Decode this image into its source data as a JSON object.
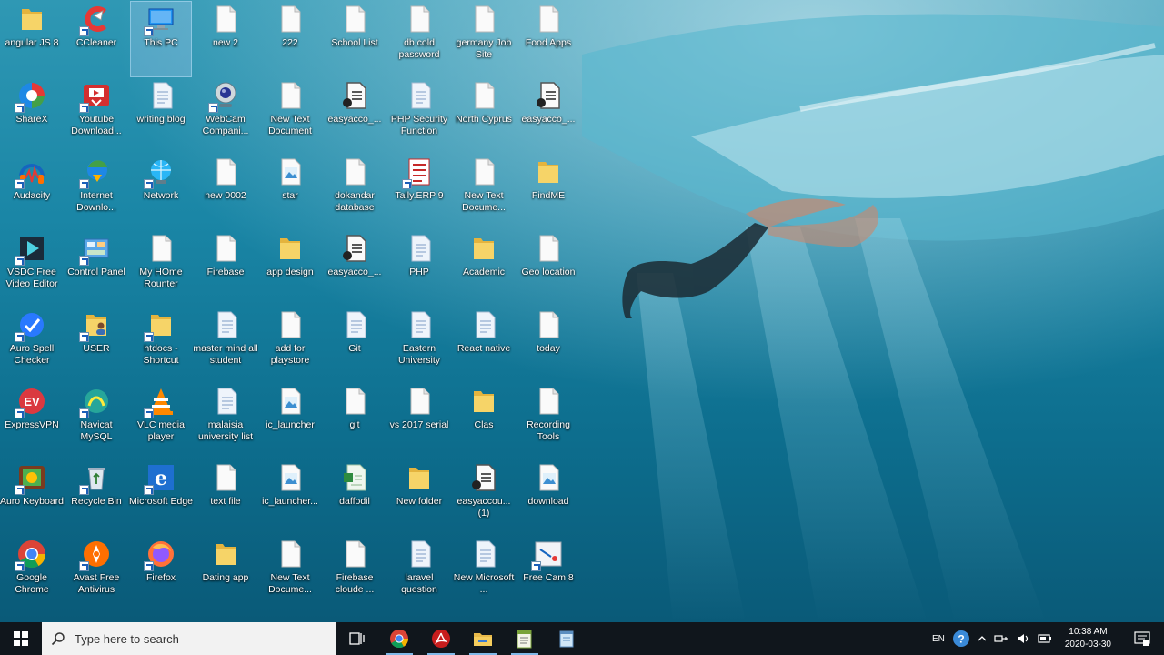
{
  "desktop_icons": [
    {
      "label": "angular JS 8",
      "type": "folder"
    },
    {
      "label": "ShareX",
      "type": "sharex"
    },
    {
      "label": "Audacity",
      "type": "audacity"
    },
    {
      "label": "VSDC Free Video Editor",
      "type": "vsdc"
    },
    {
      "label": "Auro Spell Checker",
      "type": "spell"
    },
    {
      "label": "ExpressVPN",
      "type": "expressvpn"
    },
    {
      "label": "Auro Keyboard",
      "type": "keyboard"
    },
    {
      "label": "Google Chrome",
      "type": "chrome"
    },
    {
      "label": "CCleaner",
      "type": "ccleaner"
    },
    {
      "label": "Youtube Download...",
      "type": "youtube-dl"
    },
    {
      "label": "Internet Downlo...",
      "type": "idm"
    },
    {
      "label": "Control Panel",
      "type": "control"
    },
    {
      "label": "USER",
      "type": "folder-user"
    },
    {
      "label": "Navicat MySQL",
      "type": "navicat"
    },
    {
      "label": "Recycle Bin",
      "type": "recycle"
    },
    {
      "label": "Avast Free Antivirus",
      "type": "avast"
    },
    {
      "label": "This PC",
      "type": "pc"
    },
    {
      "label": "writing blog",
      "type": "docx"
    },
    {
      "label": "Network",
      "type": "network"
    },
    {
      "label": "My HOme Rounter",
      "type": "doc"
    },
    {
      "label": "htdocs - Shortcut",
      "type": "folder"
    },
    {
      "label": "VLC media player",
      "type": "vlc"
    },
    {
      "label": "Microsoft Edge",
      "type": "edge"
    },
    {
      "label": "Firefox",
      "type": "firefox"
    },
    {
      "label": "new 2",
      "type": "doc"
    },
    {
      "label": "WebCam Compani...",
      "type": "webcam"
    },
    {
      "label": "new 0002",
      "type": "doc"
    },
    {
      "label": "Firebase",
      "type": "doc"
    },
    {
      "label": "master mind all student",
      "type": "docx"
    },
    {
      "label": "malaisia university list",
      "type": "docx"
    },
    {
      "label": "text file",
      "type": "doc"
    },
    {
      "label": "Dating app",
      "type": "folder"
    },
    {
      "label": "222",
      "type": "doc"
    },
    {
      "label": "New Text Document",
      "type": "doc"
    },
    {
      "label": "star",
      "type": "image"
    },
    {
      "label": "app design",
      "type": "folder"
    },
    {
      "label": "add for playstore",
      "type": "doc"
    },
    {
      "label": "ic_launcher",
      "type": "image"
    },
    {
      "label": "ic_launcher...",
      "type": "image"
    },
    {
      "label": "New Text Docume...",
      "type": "doc"
    },
    {
      "label": "School List",
      "type": "doc"
    },
    {
      "label": "easyacco_...",
      "type": "easyacc"
    },
    {
      "label": "dokandar database",
      "type": "doc"
    },
    {
      "label": "easyacco_...",
      "type": "easyacc"
    },
    {
      "label": "Git",
      "type": "docx"
    },
    {
      "label": "git",
      "type": "doc"
    },
    {
      "label": "daffodil",
      "type": "docx-green"
    },
    {
      "label": "Firebase cloude ...",
      "type": "doc"
    },
    {
      "label": "db cold password",
      "type": "doc"
    },
    {
      "label": "PHP Security Function",
      "type": "docx"
    },
    {
      "label": "Tally.ERP 9",
      "type": "tally"
    },
    {
      "label": "PHP",
      "type": "docx"
    },
    {
      "label": "Eastern University",
      "type": "docx"
    },
    {
      "label": "vs 2017 serial",
      "type": "doc"
    },
    {
      "label": "New folder",
      "type": "folder"
    },
    {
      "label": "laravel question",
      "type": "docx"
    },
    {
      "label": "germany Job Site",
      "type": "doc"
    },
    {
      "label": "North Cyprus",
      "type": "doc"
    },
    {
      "label": "New Text Docume...",
      "type": "doc"
    },
    {
      "label": "Academic",
      "type": "folder"
    },
    {
      "label": "React native",
      "type": "docx"
    },
    {
      "label": "Clas",
      "type": "folder"
    },
    {
      "label": "easyaccou... (1)",
      "type": "easyacc"
    },
    {
      "label": "New Microsoft ...",
      "type": "docx"
    },
    {
      "label": "Food Apps",
      "type": "doc"
    },
    {
      "label": "easyacco_...",
      "type": "easyacc"
    },
    {
      "label": "FindME",
      "type": "folder"
    },
    {
      "label": "Geo location",
      "type": "doc"
    },
    {
      "label": "today",
      "type": "doc"
    },
    {
      "label": "Recording Tools",
      "type": "doc"
    },
    {
      "label": "download",
      "type": "image"
    },
    {
      "label": "Free Cam 8",
      "type": "freecam"
    }
  ],
  "selected_icon": "This PC",
  "taskbar": {
    "search_placeholder": "Type here to search",
    "pinned": [
      "Google Chrome",
      "Adobe Reader",
      "File Explorer",
      "Notepad++",
      "Notepad"
    ],
    "tray": {
      "language": "EN",
      "time": "10:38 AM",
      "date": "2020-03-30"
    }
  },
  "colors": {
    "taskbar": "#10161c",
    "search_box": "#f2f2f2",
    "label_text": "#ffffff"
  }
}
